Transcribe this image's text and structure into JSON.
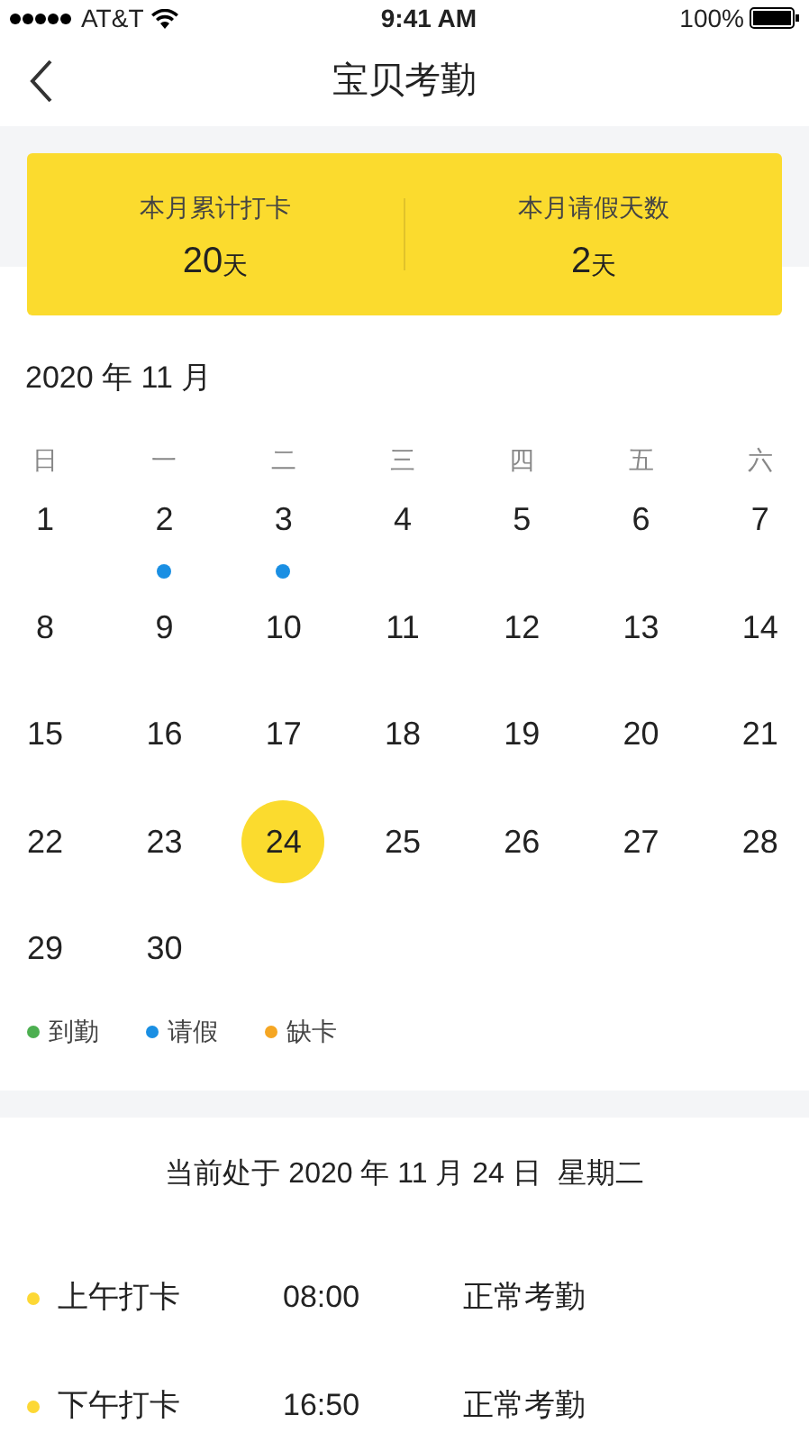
{
  "status_bar": {
    "carrier": "AT&T",
    "time": "9:41 AM",
    "battery": "100%"
  },
  "nav": {
    "title": "宝贝考勤"
  },
  "summary": [
    {
      "label": "本月累计打卡",
      "value": "20",
      "unit": "天"
    },
    {
      "label": "本月请假天数",
      "value": "2",
      "unit": "天"
    }
  ],
  "calendar": {
    "month": "2020 年 11 月",
    "weekdays": [
      "日",
      "一",
      "二",
      "三",
      "四",
      "五",
      "六"
    ],
    "days": [
      {
        "day": "1",
        "selected": false
      },
      {
        "day": "2",
        "selected": false,
        "color": "#1a8fe3"
      },
      {
        "day": "3",
        "selected": false,
        "color": "#1a8fe3"
      },
      {
        "day": "4",
        "selected": false
      },
      {
        "day": "5",
        "selected": false
      },
      {
        "day": "6",
        "selected": false
      },
      {
        "day": "7",
        "selected": false
      },
      {
        "day": "8",
        "selected": false
      },
      {
        "day": "9",
        "selected": false
      },
      {
        "day": "10",
        "selected": false
      },
      {
        "day": "11",
        "selected": false
      },
      {
        "day": "12",
        "selected": false
      },
      {
        "day": "13",
        "selected": false
      },
      {
        "day": "14",
        "selected": false
      },
      {
        "day": "15",
        "selected": false
      },
      {
        "day": "16",
        "selected": false
      },
      {
        "day": "17",
        "selected": false
      },
      {
        "day": "18",
        "selected": false
      },
      {
        "day": "19",
        "selected": false
      },
      {
        "day": "20",
        "selected": false
      },
      {
        "day": "21",
        "selected": false
      },
      {
        "day": "22",
        "selected": false
      },
      {
        "day": "23",
        "selected": false
      },
      {
        "day": "24",
        "selected": true
      },
      {
        "day": "25",
        "selected": false
      },
      {
        "day": "26",
        "selected": false
      },
      {
        "day": "27",
        "selected": false
      },
      {
        "day": "28",
        "selected": false
      },
      {
        "day": "29",
        "selected": false
      },
      {
        "day": "30",
        "selected": false
      }
    ],
    "legend": [
      {
        "label": "到勤",
        "color": "#4caf50"
      },
      {
        "label": "请假",
        "color": "#1a8fe3"
      },
      {
        "label": "缺卡",
        "color": "#f5a623"
      }
    ]
  },
  "today": {
    "text": "当前处于 2020 年 11 月 24 日  星期二",
    "records": [
      {
        "label": "上午打卡",
        "time": "08:00",
        "status": "正常考勤",
        "color": "#fdd835"
      },
      {
        "label": "下午打卡",
        "time": "16:50",
        "status": "正常考勤",
        "color": "#fdd835"
      }
    ]
  }
}
